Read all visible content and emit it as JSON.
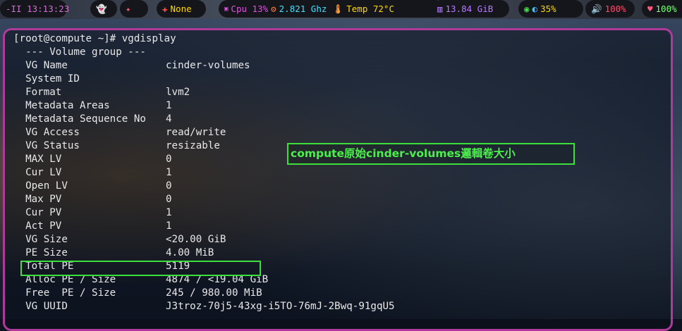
{
  "topbar": {
    "clock": "-II 13:13:23",
    "weather": "None",
    "cpu": "Cpu 13%",
    "freq": "2.821 Ghz",
    "temp": "Temp 72°C",
    "mem": "13.84 GiB",
    "brightness": "35%",
    "volume": "100%",
    "battery": "100%"
  },
  "terminal": {
    "prompt": "[root@compute ~]# vgdisplay",
    "section_header": "  --- Volume group ---",
    "rows": [
      {
        "label": "  VG Name",
        "value": "cinder-volumes"
      },
      {
        "label": "  System ID",
        "value": ""
      },
      {
        "label": "  Format",
        "value": "lvm2"
      },
      {
        "label": "  Metadata Areas",
        "value": "1"
      },
      {
        "label": "  Metadata Sequence No",
        "value": "4"
      },
      {
        "label": "  VG Access",
        "value": "read/write"
      },
      {
        "label": "  VG Status",
        "value": "resizable"
      },
      {
        "label": "  MAX LV",
        "value": "0"
      },
      {
        "label": "  Cur LV",
        "value": "1"
      },
      {
        "label": "  Open LV",
        "value": "0"
      },
      {
        "label": "  Max PV",
        "value": "0"
      },
      {
        "label": "  Cur PV",
        "value": "1"
      },
      {
        "label": "  Act PV",
        "value": "1"
      },
      {
        "label": "  VG Size",
        "value": "<20.00 GiB"
      },
      {
        "label": "  PE Size",
        "value": "4.00 MiB"
      },
      {
        "label": "  Total PE",
        "value": "5119"
      },
      {
        "label": "  Alloc PE / Size",
        "value": "4874 / <19.04 GiB"
      },
      {
        "label": "  Free  PE / Size",
        "value": "245 / 980.00 MiB"
      },
      {
        "label": "  VG UUID",
        "value": "J3troz-70j5-43xg-i5TO-76mJ-2Bwq-91gqU5"
      }
    ]
  },
  "annotation": "compute原始cinder-volumes邏輯卷大小",
  "colors": {
    "border": "#b03a9a",
    "highlight": "#3ce03c"
  }
}
